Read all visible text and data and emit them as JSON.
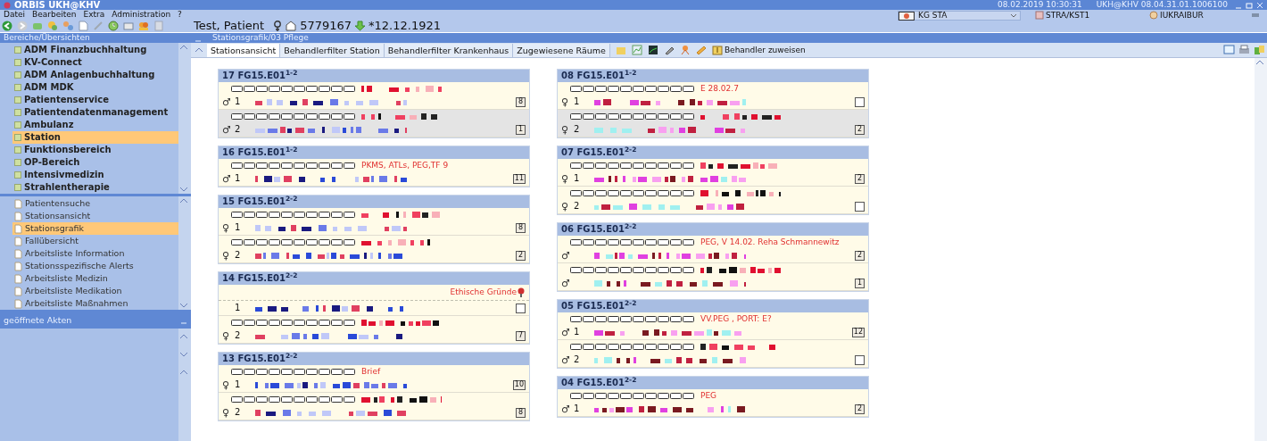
{
  "window": {
    "title": "ORBIS UKH@KHV",
    "datetime": "08.02.2019 10:30:31",
    "version": "UKH@KHV 08.04.31.01.1006100"
  },
  "menu": [
    "Datei",
    "Bearbeiten",
    "Extra",
    "Administration",
    "?"
  ],
  "patient": {
    "name": "Test, Patient",
    "id": "5779167",
    "birth": "*12.12.1921"
  },
  "context": {
    "station": "KG STA",
    "cost_center": "STRA/KST1",
    "user": "IUKRAIBUR"
  },
  "sidebar": {
    "title": "Bereiche/Übersichten",
    "areas": [
      {
        "label": "ADM Finanzbuchhaltung",
        "selected": false
      },
      {
        "label": "KV-Connect",
        "selected": false
      },
      {
        "label": "ADM Anlagenbuchhaltung",
        "selected": false
      },
      {
        "label": "ADM MDK",
        "selected": false
      },
      {
        "label": "Patientenservice",
        "selected": false
      },
      {
        "label": "Patientendatenmanagement",
        "selected": false
      },
      {
        "label": "Ambulanz",
        "selected": false
      },
      {
        "label": "Station",
        "selected": true
      },
      {
        "label": "Funktionsbereich",
        "selected": false
      },
      {
        "label": "OP-Bereich",
        "selected": false
      },
      {
        "label": "Intensivmedizin",
        "selected": false
      },
      {
        "label": "Strahlentherapie",
        "selected": false
      }
    ],
    "views": [
      {
        "label": "Patientensuche",
        "selected": false
      },
      {
        "label": "Stationsansicht",
        "selected": false
      },
      {
        "label": "Stationsgrafik",
        "selected": true
      },
      {
        "label": "Fallübersicht",
        "selected": false
      },
      {
        "label": "Arbeitsliste Information",
        "selected": false
      },
      {
        "label": "Stationsspezifische Alerts",
        "selected": false
      },
      {
        "label": "Arbeitsliste Medizin",
        "selected": false
      },
      {
        "label": "Arbeitsliste Medikation",
        "selected": false
      },
      {
        "label": "Arbeitsliste Maßnahmen",
        "selected": false
      }
    ],
    "open_records_title": "geöffnete Akten"
  },
  "content": {
    "title": "Stationsgrafik/03 Pflege",
    "tabs": [
      {
        "label": "Stationsansicht",
        "selected": true
      },
      {
        "label": "Behandlerfilter Station",
        "selected": false
      },
      {
        "label": "Behandlerfilter Krankenhaus",
        "selected": false
      },
      {
        "label": "Zugewiesene Räume",
        "selected": false
      }
    ],
    "assign_button": "Behandler zuweisen"
  },
  "room_columns": [
    [
      {
        "room": "17 FG15.E01",
        "beds": "1-2",
        "lines": [
          {
            "kind": "tasks"
          },
          {
            "kind": "bed",
            "sex": "♂",
            "number": "1",
            "count": "8",
            "shaded": false
          },
          {
            "kind": "tasks",
            "shaded": true
          },
          {
            "kind": "bed",
            "sex": "♂",
            "number": "2",
            "count": "1",
            "shaded": true
          }
        ]
      },
      {
        "room": "16 FG15.E01",
        "beds": "1-2",
        "lines": [
          {
            "kind": "tasks",
            "note": "PKMS, ATLs, PEG,TF 9"
          },
          {
            "kind": "bed",
            "sex": "♂",
            "number": "1",
            "count": "11"
          }
        ]
      },
      {
        "room": "15 FG15.E01",
        "beds": "2-2",
        "lines": [
          {
            "kind": "tasks"
          },
          {
            "kind": "bed",
            "sex": "♀",
            "number": "1",
            "count": "8"
          },
          {
            "kind": "tasks"
          },
          {
            "kind": "bed",
            "sex": "♀",
            "number": "2",
            "count": "2"
          }
        ]
      },
      {
        "room": "14 FG15.E01",
        "beds": "2-2",
        "lines": [
          {
            "kind": "notice",
            "note": "Ethische Gründe"
          },
          {
            "kind": "bed",
            "number": "1",
            "checked": false
          },
          {
            "kind": "tasks"
          },
          {
            "kind": "bed",
            "sex": "♀",
            "number": "2",
            "count": "7"
          }
        ]
      },
      {
        "room": "13 FG15.E01",
        "beds": "2-2",
        "lines": [
          {
            "kind": "tasks",
            "note": "Brief"
          },
          {
            "kind": "bed",
            "sex": "♀",
            "number": "1",
            "count": "10"
          },
          {
            "kind": "tasks"
          },
          {
            "kind": "bed",
            "sex": "♀",
            "number": "2",
            "count": "8"
          }
        ]
      }
    ],
    [
      {
        "room": "08 FG15.E01",
        "beds": "1-2",
        "lines": [
          {
            "kind": "tasks",
            "note": "E 28.02.7",
            "shaded": false
          },
          {
            "kind": "bed",
            "sex": "♀",
            "number": "1",
            "checked": false,
            "shaded": false
          },
          {
            "kind": "tasks",
            "shaded": true
          },
          {
            "kind": "bed",
            "sex": "♀",
            "number": "2",
            "count": "2",
            "shaded": true
          }
        ]
      },
      {
        "room": "07 FG15.E01",
        "beds": "2-2",
        "lines": [
          {
            "kind": "tasks"
          },
          {
            "kind": "bed",
            "sex": "♀",
            "number": "1",
            "count": "2"
          },
          {
            "kind": "tasks"
          },
          {
            "kind": "bed",
            "sex": "♀",
            "number": "2",
            "checked": false
          }
        ]
      },
      {
        "room": "06 FG15.E01",
        "beds": "2-2",
        "lines": [
          {
            "kind": "tasks",
            "note": "PEG, V 14.02. Reha Schmannewitz"
          },
          {
            "kind": "bed",
            "sex": "♂",
            "count": "2"
          },
          {
            "kind": "tasks"
          },
          {
            "kind": "bed",
            "sex": "♂",
            "count": "1"
          }
        ]
      },
      {
        "room": "05 FG15.E01",
        "beds": "2-2",
        "lines": [
          {
            "kind": "tasks",
            "note": "VV.PEG , PORT: E?"
          },
          {
            "kind": "bed",
            "sex": "♂",
            "number": "1",
            "count": "12"
          },
          {
            "kind": "tasks"
          },
          {
            "kind": "bed",
            "sex": "♂",
            "number": "2",
            "checked": false
          }
        ]
      },
      {
        "room": "04 FG15.E01",
        "beds": "2-2",
        "lines": [
          {
            "kind": "tasks",
            "note": "PEG"
          },
          {
            "kind": "bed",
            "sex": "♂",
            "number": "1",
            "count": "2"
          }
        ]
      }
    ]
  ]
}
